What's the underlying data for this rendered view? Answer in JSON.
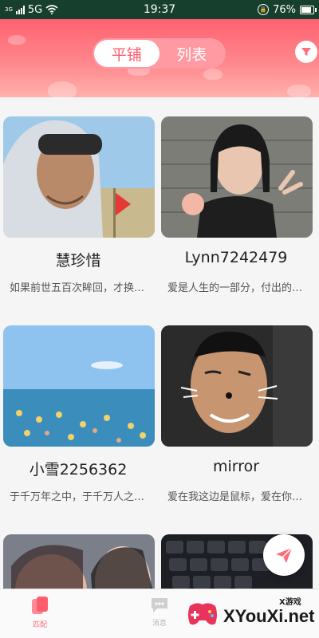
{
  "status_bar": {
    "network_small": "3G",
    "network": "5G",
    "time": "19:37",
    "battery": "76%"
  },
  "header": {
    "tabs": [
      {
        "label": "平铺",
        "active": true
      },
      {
        "label": "列表",
        "active": false
      }
    ],
    "filter_icon": "filter-funnel-icon"
  },
  "users": [
    {
      "name": "慧珍惜",
      "bio": "如果前世五百次眸回，才换来今生的一次擦肩而过"
    },
    {
      "name": "Lynn7242479",
      "bio": "爱是人生的一部分，付出的同时也在收获"
    },
    {
      "name": "小雪2256362",
      "bio": "于千万年之中，于千万人之中遇见你所遇见的人"
    },
    {
      "name": "mirror",
      "bio": "爱在我这边是鼠标，爱在你那边是键盘"
    }
  ],
  "bottom_nav": [
    {
      "label": "匹配",
      "icon": "match-cards-icon",
      "active": true
    },
    {
      "label": "消息",
      "icon": "message-bubble-icon",
      "active": false
    }
  ],
  "watermark": {
    "top": "X游戏",
    "main": "XYouXi.net"
  },
  "colors": {
    "accent": "#ff6b7a",
    "header_top": "#ff6270",
    "status_bar": "#173f2d"
  }
}
